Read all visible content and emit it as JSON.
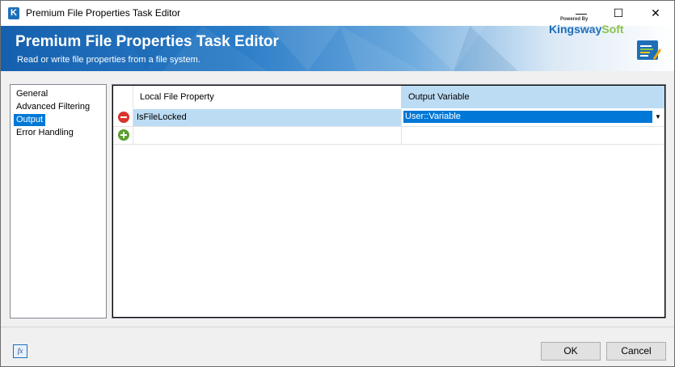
{
  "window": {
    "title": "Premium File Properties Task Editor",
    "app_icon_letter": "K",
    "controls": {
      "minimize": "—",
      "maximize": "☐",
      "close": "✕"
    }
  },
  "banner": {
    "title": "Premium File Properties Task Editor",
    "subtitle": "Read or write file properties from a file system.",
    "brand_powered": "Powered By",
    "brand_name_1": "Kingsway",
    "brand_name_2": "Soft"
  },
  "nav": {
    "items": [
      {
        "label": "General",
        "selected": false
      },
      {
        "label": "Advanced Filtering",
        "selected": false
      },
      {
        "label": "Output",
        "selected": true
      },
      {
        "label": "Error Handling",
        "selected": false
      }
    ]
  },
  "grid": {
    "columns": [
      "Local File Property",
      "Output Variable"
    ],
    "rows": [
      {
        "local_file_property": "IsFileLocked",
        "output_variable": "User::Variable"
      }
    ]
  },
  "footer": {
    "fx_label": "fx",
    "ok_label": "OK",
    "cancel_label": "Cancel"
  },
  "colors": {
    "accent": "#0078d7",
    "banner_blue": "#1560ae",
    "selection": "#bcdcf4",
    "remove_red": "#d9342b",
    "add_green": "#5aa02c"
  },
  "icons": [
    "app-k-icon",
    "remove-row-icon",
    "add-row-icon",
    "dropdown-arrow-icon",
    "expression-fx-icon",
    "kingswaysoft-product-icon"
  ]
}
